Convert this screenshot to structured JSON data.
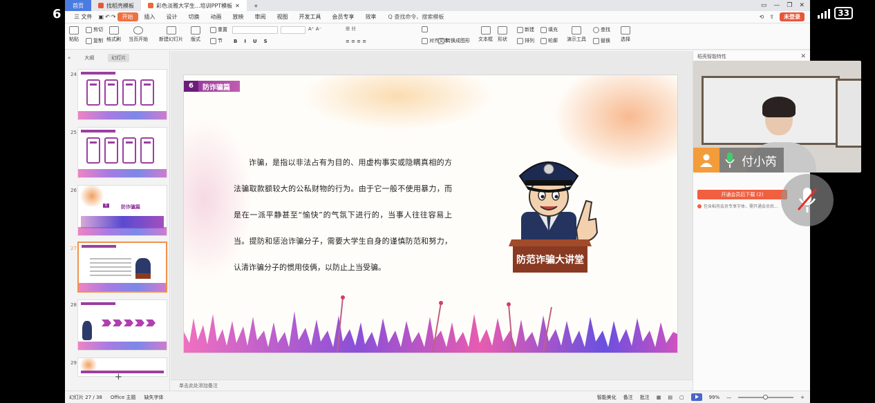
{
  "phone": {
    "time": "6",
    "battery": "33"
  },
  "tabs": {
    "home": "首页",
    "template": "找稻壳模板",
    "document": "彩色淡雅大学生...培训PPT模板"
  },
  "menubar": {
    "file": "三 文件",
    "items": [
      "开始",
      "插入",
      "设计",
      "切换",
      "动画",
      "放映",
      "审阅",
      "视图",
      "开发工具",
      "会员专享",
      "效率"
    ],
    "search": "Q 查找命令、搜索模板",
    "login": "未登录"
  },
  "ribbon": {
    "paste": "粘贴",
    "cut": "剪切",
    "copy": "复制",
    "format_painter": "格式刷",
    "play_current": "当页开始",
    "new_slide": "新建幻灯片",
    "layout": "版式",
    "section": "节",
    "reset": "重置",
    "text_box": "文本框",
    "shape": "形状",
    "arrange": "排列",
    "find": "查找",
    "replace": "替换",
    "select": "选择",
    "presenter": "演示工具",
    "new": "新建",
    "fill": "填充",
    "outline": "轮廓",
    "text_align": "对齐文本",
    "smartart": "转换成图形"
  },
  "left_panel": {
    "tab_outline": "大纲",
    "tab_slides": "幻灯片",
    "slide_numbers": [
      "24",
      "25",
      "26",
      "27",
      "28",
      "29"
    ],
    "slide26_title": "防诈骗篇",
    "add_slide": "+"
  },
  "slide": {
    "section_number": "6",
    "section_title": "防诈骗篇",
    "body": "诈骗，是指以非法占有为目的、用虚构事实或隐瞒真相的方法骗取款额较大的公私财物的行为。由于它一般不使用暴力，而是在一派平静甚至“愉快”的气氛下进行的，当事人往往容易上当。提防和惩治诈骗分子，需要大学生自身的谨慎防范和努力，认清诈骗分子的惯用伎俩，以防止上当受骗。",
    "podium_text": "防范诈骗大讲堂"
  },
  "notes": {
    "placeholder": "单击此处添加备注"
  },
  "right_panel": {
    "title": "稻壳智能特性",
    "cta": "开通会员后下载 (2)",
    "note": "包含稻壳会员专享字体，需开通会员后..."
  },
  "statusbar": {
    "slide_info": "幻灯片 27 / 38",
    "theme": "Office 主题",
    "missing_font": "缺失字体",
    "smart_beautify": "智能美化",
    "notes": "备注",
    "comments": "批注",
    "zoom": "99%"
  },
  "video": {
    "speaker_name": "付小芮"
  },
  "colors": {
    "accent": "#f07040",
    "purple": "#8e2f9a",
    "podium": "#8a3a22"
  }
}
